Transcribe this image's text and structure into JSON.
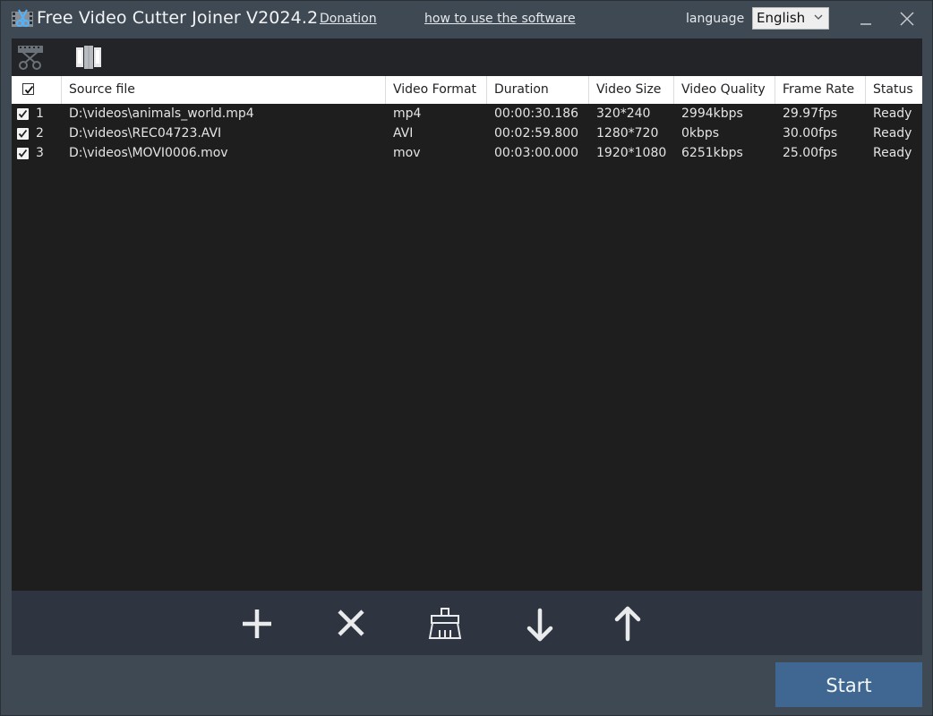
{
  "window": {
    "title": "Free Video Cutter Joiner V2024.2",
    "donation_link": "Donation",
    "howto_link": "how to use the software",
    "language_label": "language",
    "language_value": "English",
    "minimize_glyph": "—",
    "close_glyph": "✕"
  },
  "toolbar": {
    "tools": [
      {
        "name": "cut-tool",
        "icon": "scissors-film-icon",
        "state": "inactive"
      },
      {
        "name": "join-tool",
        "icon": "film-join-icon",
        "state": "active"
      }
    ]
  },
  "table": {
    "columns": [
      "Source file",
      "Video Format",
      "Duration",
      "Video Size",
      "Video Quality",
      "Frame Rate",
      "Status"
    ],
    "select_all_checked": true,
    "rows": [
      {
        "checked": true,
        "index": "1",
        "source": "D:\\videos\\animals_world.mp4",
        "format": "mp4",
        "duration": "00:00:30.186",
        "size": "320*240",
        "quality": "2994kbps",
        "fps": "29.97fps",
        "status": "Ready"
      },
      {
        "checked": true,
        "index": "2",
        "source": "D:\\videos\\REC04723.AVI",
        "format": "AVI",
        "duration": "00:02:59.800",
        "size": "1280*720",
        "quality": "0kbps",
        "fps": "30.00fps",
        "status": "Ready"
      },
      {
        "checked": true,
        "index": "3",
        "source": "D:\\videos\\MOVI0006.mov",
        "format": "mov",
        "duration": "00:03:00.000",
        "size": "1920*1080",
        "quality": "6251kbps",
        "fps": "25.00fps",
        "status": "Ready"
      }
    ]
  },
  "actions": [
    {
      "name": "add",
      "icon": "plus-icon"
    },
    {
      "name": "remove",
      "icon": "x-icon"
    },
    {
      "name": "clear",
      "icon": "broom-icon"
    },
    {
      "name": "move-down",
      "icon": "arrow-down-icon"
    },
    {
      "name": "move-up",
      "icon": "arrow-up-icon"
    }
  ],
  "start_label": "Start",
  "colors": {
    "window_bg": "#3f4953",
    "panel_bg": "#1e1e1e",
    "bottom_bar_bg": "#2f3540",
    "start_button": "#3f6791"
  }
}
